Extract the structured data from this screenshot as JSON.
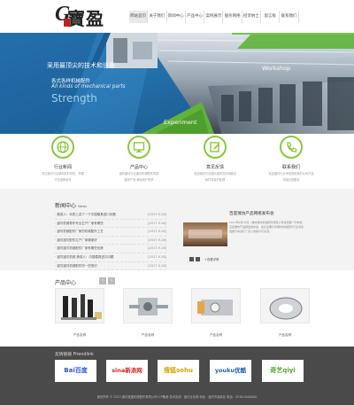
{
  "header": {
    "logo": {
      "g": "G",
      "cn": "寶盈"
    },
    "nav": [
      {
        "label": "网站首页",
        "active": true
      },
      {
        "label": "关于我们",
        "active": false
      },
      {
        "label": "新闻中心",
        "active": false
      },
      {
        "label": "产品中心",
        "active": false
      },
      {
        "label": "案例展示",
        "active": false
      },
      {
        "label": "服务网络",
        "active": false
      },
      {
        "label": "招贤纳士",
        "active": false
      },
      {
        "label": "留言板",
        "active": false
      },
      {
        "label": "联系我们",
        "active": false
      }
    ]
  },
  "banner": {
    "line1": "采用最顶尖的技术和设备",
    "line2": "各式各样机械配件",
    "line3": "All kinds of mechanical parts",
    "line4": "Strength",
    "workshop": "Workshop",
    "experiment": "Experiment",
    "colors": {
      "blue": "#2a7ab8",
      "green": "#5fb23a",
      "dark_green": "#1e8f5e"
    }
  },
  "services": [
    {
      "title": "行业新闻",
      "icon": "globe-icon",
      "desc1": "关注潍坊行业新闻实时动态，掌握",
      "desc2": "行业最新资讯"
    },
    {
      "title": "产品中心",
      "icon": "monitor-icon",
      "desc1": "潍坊潍坊行业潍坊机械配件质量",
      "desc2": "超优产品 满足用户需求"
    },
    {
      "title": "意见反馈",
      "icon": "edit-icon",
      "desc1": "欢迎潍坊行业提出宝贵意见和建议",
      "desc2": "我们将及时处理"
    },
    {
      "title": "联系我们",
      "icon": "phone-icon",
      "desc1": "欢迎潍坊行业来电咨询我们公司产品",
      "desc2": "竭诚为您服务"
    }
  ],
  "news": {
    "title": "新闻中心",
    "title_en": "News",
    "items": [
      {
        "text": "· 美成人：本质上讲了一下中国模具进口问题",
        "date": "[2017-9-18]"
      },
      {
        "text": "· 潍坊机械零件专业生产厂家有哪些",
        "date": "[2017-9-18]"
      },
      {
        "text": "· 潍坊机械配件厂家的机械配件工艺",
        "date": "[2017-9-18]"
      },
      {
        "text": "· 潍坊潍坊配件生产厂家哪家好",
        "date": "[2017-9-18]"
      },
      {
        "text": "· 潍坊潍坊机械配件厂家有哪些优势",
        "date": "[2017-9-18]"
      },
      {
        "text": "· 潍坊潍坊机械 美成人：中国模具进口问题",
        "date": "[2017-9-18]"
      },
      {
        "text": "· 潍坊潍坊机械配件的一些常识",
        "date": "[2017-9-18]"
      }
    ],
    "feature_head": "百度潍坊产品网络发布会",
    "feature_desc": "2017年9月18日—潍坊潍坊机械配件有限公司总经理一行参加百度潍坊产品网络发布会，会议主要针对潍坊机械配件行业未来发展方向进行了深入的探讨与交流。",
    "more": "+查看详情"
  },
  "products": {
    "title": "产品中心",
    "prev": "‹",
    "next": "›",
    "items": [
      {
        "caption": "产品名称"
      },
      {
        "caption": "产品名称"
      },
      {
        "caption": "产品名称"
      },
      {
        "caption": "产品名称"
      }
    ]
  },
  "friendlinks": {
    "title": "友情链接 Friendlink",
    "items": [
      {
        "label": "Bai百度",
        "color": "#2d5bd3"
      },
      {
        "label": "sina新浪网",
        "color": "#d3261c"
      },
      {
        "label": "搜狐sohu",
        "color": "#d4a300"
      },
      {
        "label": "youku优酷",
        "color": "#1e5fb8"
      },
      {
        "label": "奇艺qiyi",
        "color": "#55a532"
      }
    ]
  },
  "footer": {
    "copyright": "版权所有 © 2015  潍坊宝盈机械配件有限公司  ICP备案  技术支持：潍坊企业网  地址：潍坊市高新区  电话：0536-0000000"
  }
}
